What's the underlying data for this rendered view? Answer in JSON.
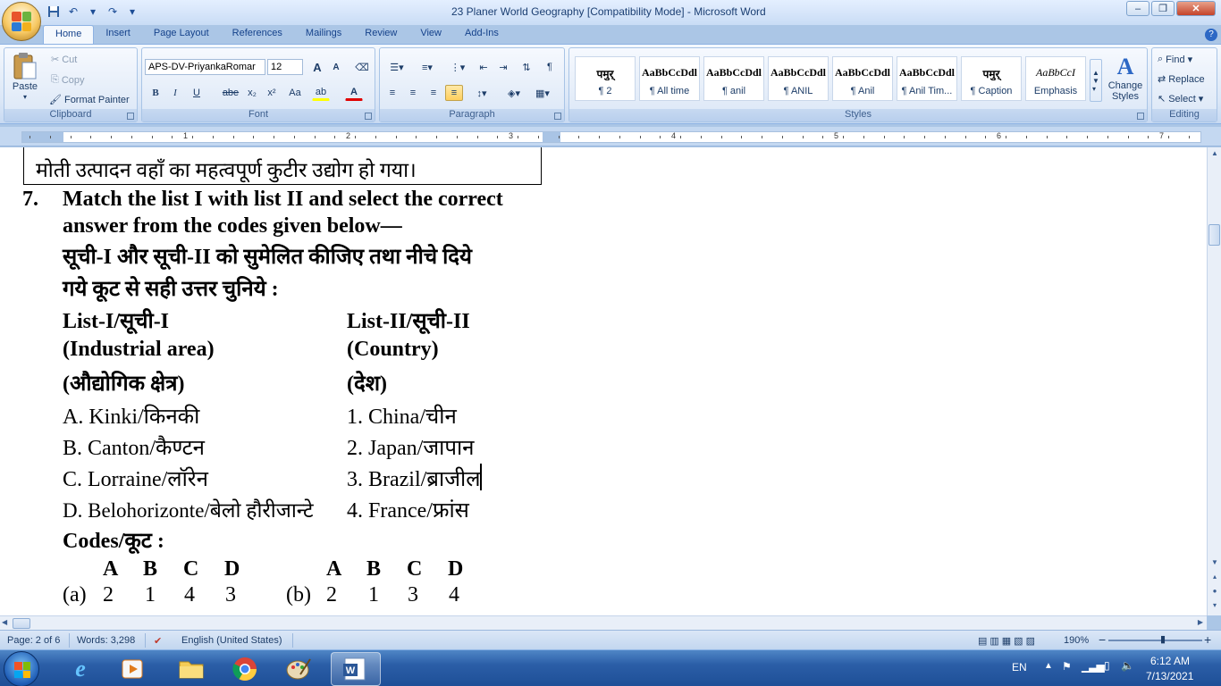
{
  "window": {
    "title": "23 Planer World Geography [Compatibility Mode] - Microsoft Word",
    "controls": {
      "minimize": "–",
      "maximize": "❐",
      "close": "✕"
    }
  },
  "qat": {
    "save_icon": "save-icon",
    "undo_icon": "undo-icon",
    "redo_icon": "redo-icon",
    "customize_icon": "chevron-down-icon"
  },
  "tabs": [
    "Home",
    "Insert",
    "Page Layout",
    "References",
    "Mailings",
    "Review",
    "View",
    "Add-Ins"
  ],
  "help": "?",
  "clipboard": {
    "label": "Clipboard",
    "paste": "Paste",
    "cut": "Cut",
    "copy": "Copy",
    "format_painter": "Format Painter"
  },
  "font": {
    "label": "Font",
    "name": "APS-DV-PriyankaRomar",
    "size": "12",
    "grow": "A",
    "shrink": "A",
    "bold": "B",
    "italic": "I",
    "underline": "U",
    "strikethrough": "abe",
    "subscript": "x₂",
    "superscript": "x²",
    "change_case": "Aa",
    "highlight": "ab",
    "font_color": "A",
    "highlight_color": "#ffff00",
    "font_color_value": "#e00000"
  },
  "paragraph": {
    "label": "Paragraph"
  },
  "styles": {
    "label": "Styles",
    "tiles": [
      {
        "sample": "पमुर्",
        "name": "¶ 2"
      },
      {
        "sample": "AaBbCcDdl",
        "name": "¶ All time"
      },
      {
        "sample": "AaBbCcDdl",
        "name": "¶ anil"
      },
      {
        "sample": "AaBbCcDdl",
        "name": "¶ ANIL"
      },
      {
        "sample": "AaBbCcDdl",
        "name": "¶ Anil"
      },
      {
        "sample": "AaBbCcDdl",
        "name": "¶ Anil Tim..."
      },
      {
        "sample": "पमुर्",
        "name": "¶ Caption"
      },
      {
        "sample": "AaBbCcI",
        "name": "Emphasis"
      }
    ],
    "change_styles": "Change Styles"
  },
  "editing": {
    "label": "Editing",
    "find": "Find",
    "replace": "Replace",
    "select": "Select"
  },
  "ruler": {
    "numbers": [
      "1",
      "2",
      "3",
      "4",
      "5",
      "6",
      "7"
    ],
    "tab_selector": "L"
  },
  "document": {
    "prev_line": "मोती उत्पादन वहाँ का महत्वपूर्ण कुटीर उद्योग हो गया।",
    "q_number": "7.",
    "q_en_1": "Match the list I with list II and select the correct",
    "q_en_2": "answer from the codes given below—",
    "q_hi_1": "सूची-I और सूची-II को सुमेलित कीजिए तथा नीचे दिये",
    "q_hi_2": "गये कूट से सही उत्तर चुनिये :",
    "list1_head": "List-I/सूची-I",
    "list2_head": "List-II/सूची-II",
    "list1_sub_en": "(Industrial area)",
    "list2_sub_en": "(Country)",
    "list1_sub_hi": "(औद्योगिक क्षेत्र)",
    "list2_sub_hi": "(देश)",
    "list1": [
      "A. Kinki/किनकी",
      "B. Canton/कैण्टन",
      "C. Lorraine/लॉरेन",
      "D. Belohorizonte/बेलो हौरीजान्टे"
    ],
    "list2": [
      "1. China/चीन",
      "2. Japan/जापान",
      "3. Brazil/ब्राजील",
      "4. France/फ्रांस"
    ],
    "codes_label": "Codes/कूट :",
    "code_headers": [
      "A",
      "B",
      "C",
      "D"
    ],
    "option_a": {
      "label": "(a)",
      "values": [
        "2",
        "1",
        "4",
        "3"
      ]
    },
    "option_b": {
      "label": "(b)",
      "values": [
        "2",
        "1",
        "3",
        "4"
      ]
    }
  },
  "status": {
    "page": "Page: 2 of 6",
    "words": "Words: 3,298",
    "language": "English (United States)",
    "zoom": "190%",
    "zoom_out": "−",
    "zoom_in": "+"
  },
  "tray": {
    "lang": "EN",
    "time": "6:12 AM",
    "date": "7/13/2021"
  }
}
